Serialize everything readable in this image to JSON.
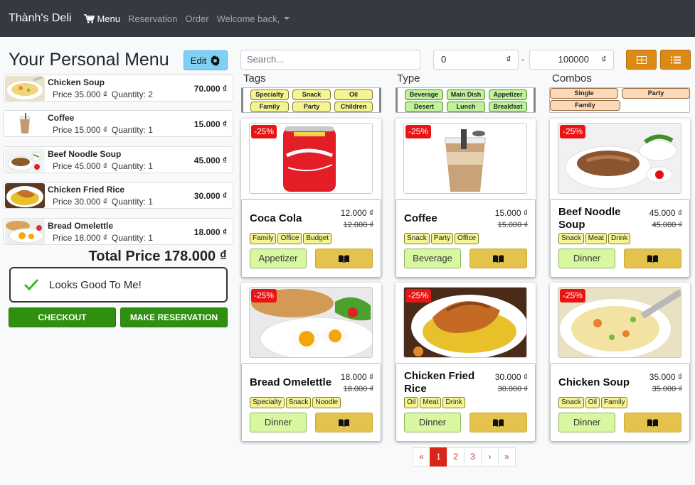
{
  "nav": {
    "brand": "Thành's Deli",
    "menu": "Menu",
    "reservation": "Reservation",
    "order": "Order",
    "welcome": "Welcome back,"
  },
  "personal_menu": {
    "title": "Your Personal Menu",
    "edit_label": "Edit",
    "items": [
      {
        "name": "Chicken Soup",
        "price": "Price 35.000 ₫",
        "quantity": "Quantity: 2",
        "total": "70.000 ₫"
      },
      {
        "name": "Coffee",
        "price": "Price 15.000 ₫",
        "quantity": "Quantity: 1",
        "total": "15.000 ₫"
      },
      {
        "name": "Beef Noodle Soup",
        "price": "Price 45.000 ₫",
        "quantity": "Quantity: 1",
        "total": "45.000 ₫"
      },
      {
        "name": "Chicken Fried Rice",
        "price": "Price 30.000 ₫",
        "quantity": "Quantity: 1",
        "total": "30.000 ₫"
      },
      {
        "name": "Bread Omelettle",
        "price": "Price 18.000 ₫",
        "quantity": "Quantity: 1",
        "total": "18.000 ₫"
      }
    ],
    "total_price": "Total Price 178.000 ₫",
    "status": "Looks Good To Me!",
    "checkout": "CHECKOUT",
    "reserve": "MAKE RESERVATION"
  },
  "filters": {
    "search_placeholder": "Search...",
    "min_price": "0",
    "max_price": "100000",
    "currency": "₫",
    "separator": "-",
    "tags_label": "Tags",
    "type_label": "Type",
    "combos_label": "Combos",
    "tags": [
      "Specialty",
      "Snack",
      "Oil",
      "Family",
      "Party",
      "Children"
    ],
    "types": [
      "Beverage",
      "Main Dish",
      "Appetizer",
      "Desert",
      "Lunch",
      "Breakfast"
    ],
    "combos": [
      "Single",
      "Party",
      "Family"
    ]
  },
  "products": [
    {
      "discount": "-25%",
      "name": "Coca Cola",
      "price": "12.000 ₫",
      "old_price": "12.000 ₫",
      "tags": [
        "Family",
        "Office",
        "Budget"
      ],
      "category": "Appetizer"
    },
    {
      "discount": "-25%",
      "name": "Coffee",
      "price": "15.000 ₫",
      "old_price": "15.000 ₫",
      "tags": [
        "Snack",
        "Party",
        "Office"
      ],
      "category": "Beverage"
    },
    {
      "discount": "-25%",
      "name": "Beef Noodle Soup",
      "price": "45.000 ₫",
      "old_price": "45.000 ₫",
      "tags": [
        "Snack",
        "Meat",
        "Drink"
      ],
      "category": "Dinner"
    },
    {
      "discount": "-25%",
      "name": "Bread Omelettle",
      "price": "18.000 ₫",
      "old_price": "18.000 ₫",
      "tags": [
        "Specialty",
        "Snack",
        "Noodle"
      ],
      "category": "Dinner"
    },
    {
      "discount": "-25%",
      "name": "Chicken Fried Rice",
      "price": "30.000 ₫",
      "old_price": "30.000 ₫",
      "tags": [
        "Oil",
        "Meat",
        "Drink"
      ],
      "category": "Dinner"
    },
    {
      "discount": "-25%",
      "name": "Chicken Soup",
      "price": "35.000 ₫",
      "old_price": "35.000 ₫",
      "tags": [
        "Snack",
        "Oil",
        "Family"
      ],
      "category": "Dinner"
    }
  ],
  "pagination": {
    "first": "«",
    "prev": "‹",
    "next": "›",
    "last": "»",
    "pages": [
      "1",
      "2",
      "3"
    ],
    "current": "1"
  },
  "colors": {
    "navbar": "#343a40",
    "checkout": "#2f9010",
    "discount": "#e81515",
    "view_toggle": "#dc8a16",
    "active_page": "#d8251a"
  }
}
